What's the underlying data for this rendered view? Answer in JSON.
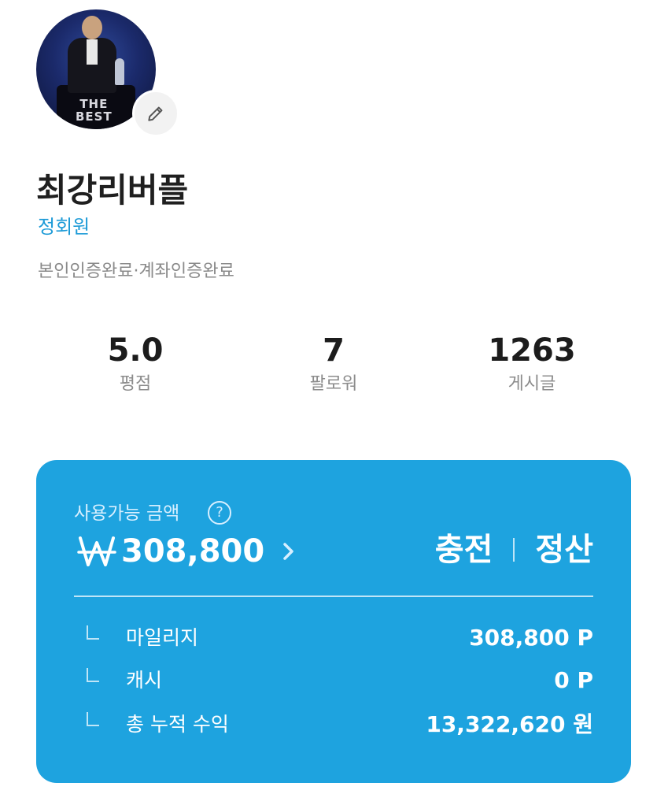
{
  "profile": {
    "nickname": "최강리버플",
    "grade": "정회원",
    "verification": "본인인증완료·계좌인증완료"
  },
  "stats": [
    {
      "value": "5.0",
      "label": "평점"
    },
    {
      "value": "7",
      "label": "팔로워"
    },
    {
      "value": "1263",
      "label": "게시글"
    }
  ],
  "wallet": {
    "available_label": "사용가능 금액",
    "help_symbol": "?",
    "amount": "308,800",
    "charge_label": "충전",
    "settle_label": "정산",
    "rows": [
      {
        "label": "마일리지",
        "value": "308,800 P"
      },
      {
        "label": "캐시",
        "value": "0 P"
      },
      {
        "label": "총 누적 수익",
        "value": "13,322,620 원"
      }
    ]
  },
  "avatar": {
    "podium_text_1": "THE",
    "podium_text_2": "BEST"
  },
  "colors": {
    "accent": "#1ea3df",
    "grade": "#1e9bd7"
  },
  "icons": {
    "edit": "pencil-icon",
    "help": "question-icon",
    "currency": "won-icon",
    "more": "chevron-right-icon"
  }
}
